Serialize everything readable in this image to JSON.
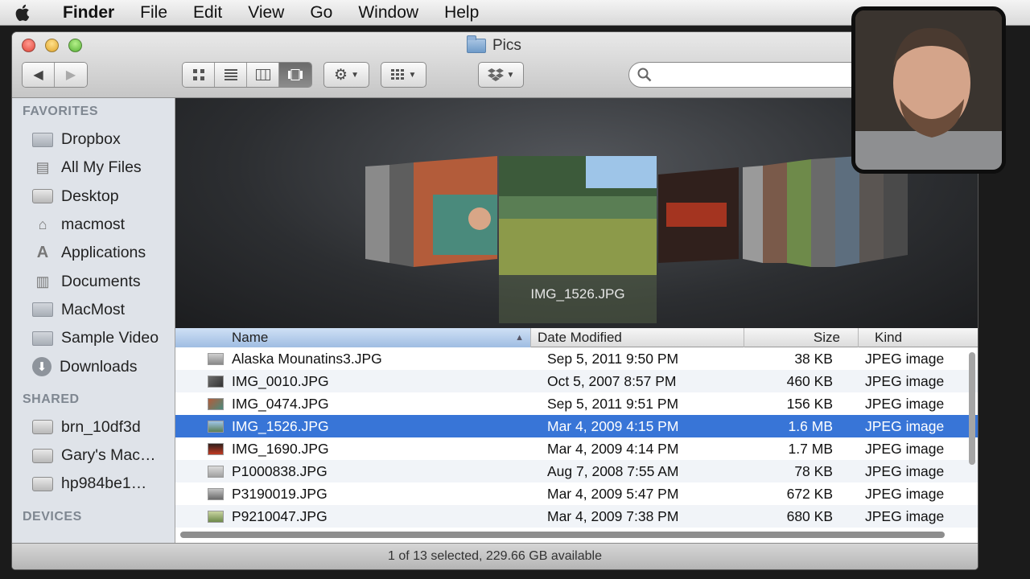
{
  "menubar": {
    "apple_icon": "apple-icon",
    "items": [
      "Finder",
      "File",
      "Edit",
      "View",
      "Go",
      "Window",
      "Help"
    ]
  },
  "window": {
    "title": "Pics",
    "search_placeholder": ""
  },
  "sidebar": {
    "favorites_header": "FAVORITES",
    "favorites": [
      {
        "label": "Dropbox",
        "icon": "folder-icon"
      },
      {
        "label": "All My Files",
        "icon": "all-files-icon"
      },
      {
        "label": "Desktop",
        "icon": "desktop-icon"
      },
      {
        "label": "macmost",
        "icon": "home-icon"
      },
      {
        "label": "Applications",
        "icon": "applications-icon"
      },
      {
        "label": "Documents",
        "icon": "documents-icon"
      },
      {
        "label": "MacMost",
        "icon": "folder-icon"
      },
      {
        "label": "Sample Video",
        "icon": "folder-icon"
      },
      {
        "label": "Downloads",
        "icon": "downloads-icon"
      }
    ],
    "shared_header": "SHARED",
    "shared": [
      {
        "label": "brn_10df3d",
        "icon": "network-computer-icon"
      },
      {
        "label": "Gary's Mac…",
        "icon": "network-computer-icon"
      },
      {
        "label": "hp984be1…",
        "icon": "network-computer-icon"
      }
    ],
    "devices_header": "DEVICES"
  },
  "coverflow": {
    "caption": "IMG_1526.JPG"
  },
  "list": {
    "columns": {
      "name": "Name",
      "date": "Date Modified",
      "size": "Size",
      "kind": "Kind"
    },
    "rows": [
      {
        "name": "Alaska Mounatins3.JPG",
        "date": "Sep 5, 2011 9:50 PM",
        "size": "38 KB",
        "kind": "JPEG image"
      },
      {
        "name": "IMG_0010.JPG",
        "date": "Oct 5, 2007 8:57 PM",
        "size": "460 KB",
        "kind": "JPEG image"
      },
      {
        "name": "IMG_0474.JPG",
        "date": "Sep 5, 2011 9:51 PM",
        "size": "156 KB",
        "kind": "JPEG image"
      },
      {
        "name": "IMG_1526.JPG",
        "date": "Mar 4, 2009 4:15 PM",
        "size": "1.6 MB",
        "kind": "JPEG image",
        "selected": true
      },
      {
        "name": "IMG_1690.JPG",
        "date": "Mar 4, 2009 4:14 PM",
        "size": "1.7 MB",
        "kind": "JPEG image"
      },
      {
        "name": "P1000838.JPG",
        "date": "Aug 7, 2008 7:55 AM",
        "size": "78 KB",
        "kind": "JPEG image"
      },
      {
        "name": "P3190019.JPG",
        "date": "Mar 4, 2009 5:47 PM",
        "size": "672 KB",
        "kind": "JPEG image"
      },
      {
        "name": "P9210047.JPG",
        "date": "Mar 4, 2009 7:38 PM",
        "size": "680 KB",
        "kind": "JPEG image"
      }
    ]
  },
  "statusbar": {
    "text": "1 of 13 selected, 229.66 GB available"
  },
  "colors": {
    "selection": "#3875d7",
    "sidebar_bg": "#dfe3e9",
    "coverflow_bg": "#2c2e31"
  }
}
